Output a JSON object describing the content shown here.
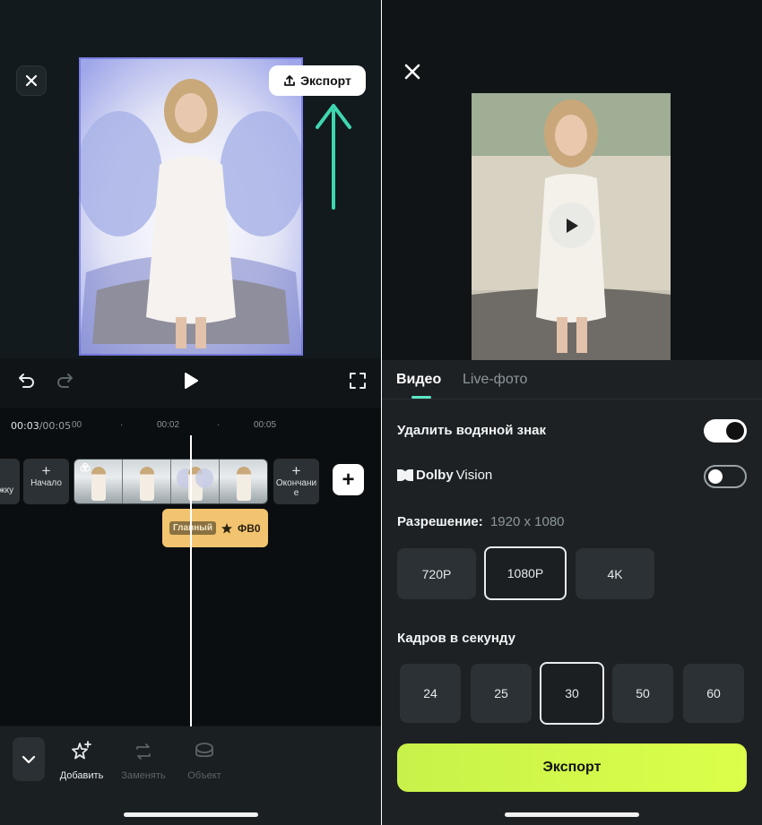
{
  "left": {
    "export_button": "Экспорт",
    "time_current": "00:03",
    "time_total": "/00:05",
    "ticks": [
      "00",
      "00:02",
      "00:05"
    ],
    "clips": {
      "prev_partial": "жку",
      "start": "Начало",
      "end_line1": "Окончани",
      "end_line2": "е"
    },
    "sticker_track": {
      "tag": "Главный",
      "text": "ФВ0"
    },
    "tools": [
      {
        "label": "Добавить",
        "icon": "sticker-add-icon",
        "active": true
      },
      {
        "label": "Заменять",
        "icon": "replace-icon",
        "active": false
      },
      {
        "label": "Объект",
        "icon": "object-icon",
        "active": false
      }
    ],
    "colors": {
      "sticker": "#f2c46f",
      "annotation_arrow": "#3fd6b0"
    }
  },
  "right": {
    "tabs": [
      "Видео",
      "Live-фото"
    ],
    "remove_watermark_label": "Удалить водяной знак",
    "remove_watermark_on": true,
    "dolby_brand": "Dolby",
    "dolby_suffix": "Vision",
    "dolby_on": false,
    "resolution_label": "Разрешение:",
    "resolution_value": "1920 x 1080",
    "resolution_options": [
      "720P",
      "1080P",
      "4K"
    ],
    "resolution_selected": "1080P",
    "fps_label": "Кадров в секунду",
    "fps_options": [
      "24",
      "25",
      "30",
      "50",
      "60"
    ],
    "fps_selected": "30",
    "export_button": "Экспорт",
    "colors": {
      "accent": "#d4fb4a",
      "tab_underline": "#5ce8c5"
    }
  }
}
